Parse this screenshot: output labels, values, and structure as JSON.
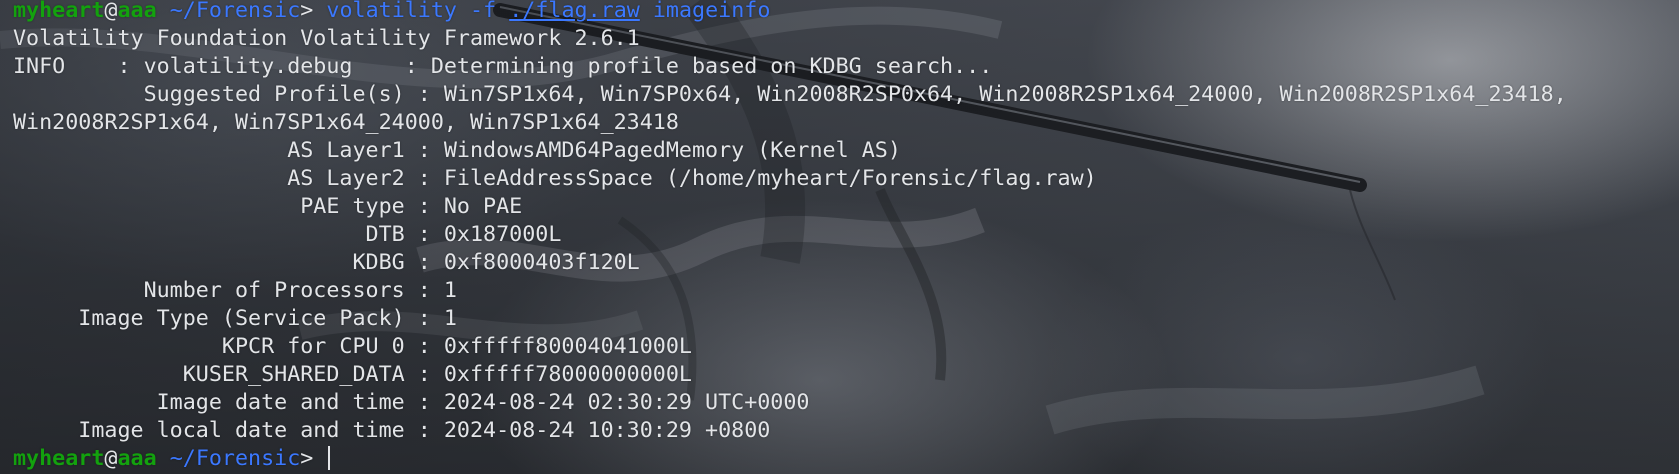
{
  "prompt": {
    "user": "myheart",
    "at": "@",
    "host": "aaa",
    "path": "~/Forensic",
    "symbol": ">"
  },
  "command": {
    "program": "volatility",
    "flag": "-f",
    "file": "./flag.raw",
    "plugin": "imageinfo"
  },
  "output": [
    "Volatility Foundation Volatility Framework 2.6.1",
    "INFO    : volatility.debug    : Determining profile based on KDBG search...",
    "          Suggested Profile(s) : Win7SP1x64, Win7SP0x64, Win2008R2SP0x64, Win2008R2SP1x64_24000, Win2008R2SP1x64_23418,",
    "Win2008R2SP1x64, Win7SP1x64_24000, Win7SP1x64_23418",
    "                     AS Layer1 : WindowsAMD64PagedMemory (Kernel AS)",
    "                     AS Layer2 : FileAddressSpace (/home/myheart/Forensic/flag.raw)",
    "                      PAE type : No PAE",
    "                           DTB : 0x187000L",
    "                          KDBG : 0xf8000403f120L",
    "          Number of Processors : 1",
    "     Image Type (Service Pack) : 1",
    "                KPCR for CPU 0 : 0xfffff80004041000L",
    "             KUSER_SHARED_DATA : 0xfffff78000000000L",
    "           Image date and time : 2024-08-24 02:30:29 UTC+0000",
    "     Image local date and time : 2024-08-24 10:30:29 +0800"
  ],
  "colors": {
    "user_host": "#13a10e",
    "path_command": "#3b78ff",
    "text": "#e3e5e8"
  }
}
